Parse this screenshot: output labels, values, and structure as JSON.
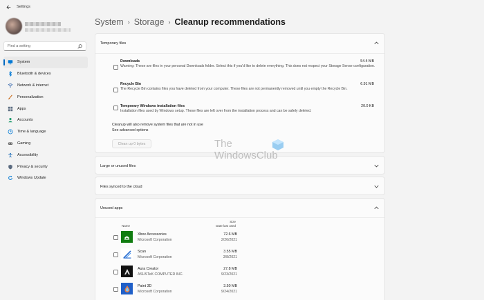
{
  "window": {
    "title": "Settings"
  },
  "sidebar": {
    "search_placeholder": "Find a setting",
    "items": [
      {
        "label": "System",
        "icon": "monitor-icon",
        "color": "#0078d4",
        "active": true
      },
      {
        "label": "Bluetooth & devices",
        "icon": "bluetooth-icon",
        "color": "#0078d4"
      },
      {
        "label": "Network & internet",
        "icon": "wifi-icon",
        "color": "#2b5fa8"
      },
      {
        "label": "Personalization",
        "icon": "brush-icon",
        "color": "#c86a1a"
      },
      {
        "label": "Apps",
        "icon": "apps-icon",
        "color": "#5b6b80"
      },
      {
        "label": "Accounts",
        "icon": "person-icon",
        "color": "#1b9a6b"
      },
      {
        "label": "Time & language",
        "icon": "globe-clock-icon",
        "color": "#0078d4"
      },
      {
        "label": "Gaming",
        "icon": "gamepad-icon",
        "color": "#6b6b6b"
      },
      {
        "label": "Accessibility",
        "icon": "accessibility-icon",
        "color": "#1f6fb8"
      },
      {
        "label": "Privacy & security",
        "icon": "shield-icon",
        "color": "#5b6b80"
      },
      {
        "label": "Windows Update",
        "icon": "update-icon",
        "color": "#0078d4"
      }
    ]
  },
  "breadcrumb": {
    "crumbs": [
      "System",
      "Storage"
    ],
    "current": "Cleanup recommendations"
  },
  "temporary_files": {
    "title": "Temporary files",
    "files": [
      {
        "name": "Downloads",
        "size": "54.4 MB",
        "desc": "Warning: These are files in your personal Downloads folder. Select this if you'd like to delete everything. This does not respect your Storage Sense configuration."
      },
      {
        "name": "Recycle Bin",
        "size": "6.91 MB",
        "desc": "The Recycle Bin contains files you have deleted from your computer. These files are not permanently removed until you empty the Recycle Bin."
      },
      {
        "name": "Temporary Windows installation files",
        "size": "20.0 KB",
        "desc": "Installation files used by Windows setup.  These files are left over from the installation process and can be safely deleted."
      }
    ],
    "note": "Cleanup will also remove system files that are not in use",
    "advanced_link": "See advanced options",
    "cleanup_button": "Clean up 0 bytes"
  },
  "large_files": {
    "title": "Large or unused files"
  },
  "cloud_files": {
    "title": "Files synced to the cloud"
  },
  "unused_apps": {
    "title": "Unused apps",
    "col_name": "Name",
    "col_size": "Size",
    "col_date": "Date last used",
    "apps": [
      {
        "name": "Xbox Accessories",
        "publisher": "Microsoft Corporation",
        "size": "72.6 MB",
        "date": "2/26/2021",
        "icon": "xbox-accessories-icon",
        "color": "#107c10"
      },
      {
        "name": "Scan",
        "publisher": "Microsoft Corporation",
        "size": "3.55 MB",
        "date": "3/8/2021",
        "icon": "scan-icon",
        "color": "#ffffff"
      },
      {
        "name": "Aura Creator",
        "publisher": "ASUSTeK COMPUTER INC.",
        "size": "27.8 MB",
        "date": "9/23/2021",
        "icon": "aura-creator-icon",
        "color": "#111111"
      },
      {
        "name": "Paint 3D",
        "publisher": "Microsoft Corporation",
        "size": "3.50 MB",
        "date": "9/24/2021",
        "icon": "paint-3d-icon",
        "color": "#1f5fc8"
      }
    ]
  },
  "watermark": {
    "line1": "The",
    "line2": "WindowsClub"
  }
}
